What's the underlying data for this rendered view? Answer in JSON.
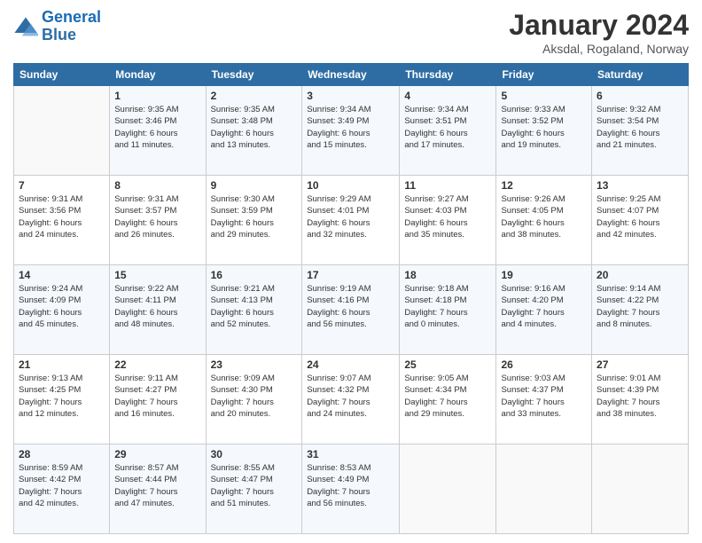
{
  "logo": {
    "line1": "General",
    "line2": "Blue"
  },
  "title": "January 2024",
  "subtitle": "Aksdal, Rogaland, Norway",
  "header_days": [
    "Sunday",
    "Monday",
    "Tuesday",
    "Wednesday",
    "Thursday",
    "Friday",
    "Saturday"
  ],
  "weeks": [
    [
      {
        "day": "",
        "info": ""
      },
      {
        "day": "1",
        "info": "Sunrise: 9:35 AM\nSunset: 3:46 PM\nDaylight: 6 hours\nand 11 minutes."
      },
      {
        "day": "2",
        "info": "Sunrise: 9:35 AM\nSunset: 3:48 PM\nDaylight: 6 hours\nand 13 minutes."
      },
      {
        "day": "3",
        "info": "Sunrise: 9:34 AM\nSunset: 3:49 PM\nDaylight: 6 hours\nand 15 minutes."
      },
      {
        "day": "4",
        "info": "Sunrise: 9:34 AM\nSunset: 3:51 PM\nDaylight: 6 hours\nand 17 minutes."
      },
      {
        "day": "5",
        "info": "Sunrise: 9:33 AM\nSunset: 3:52 PM\nDaylight: 6 hours\nand 19 minutes."
      },
      {
        "day": "6",
        "info": "Sunrise: 9:32 AM\nSunset: 3:54 PM\nDaylight: 6 hours\nand 21 minutes."
      }
    ],
    [
      {
        "day": "7",
        "info": "Sunrise: 9:31 AM\nSunset: 3:56 PM\nDaylight: 6 hours\nand 24 minutes."
      },
      {
        "day": "8",
        "info": "Sunrise: 9:31 AM\nSunset: 3:57 PM\nDaylight: 6 hours\nand 26 minutes."
      },
      {
        "day": "9",
        "info": "Sunrise: 9:30 AM\nSunset: 3:59 PM\nDaylight: 6 hours\nand 29 minutes."
      },
      {
        "day": "10",
        "info": "Sunrise: 9:29 AM\nSunset: 4:01 PM\nDaylight: 6 hours\nand 32 minutes."
      },
      {
        "day": "11",
        "info": "Sunrise: 9:27 AM\nSunset: 4:03 PM\nDaylight: 6 hours\nand 35 minutes."
      },
      {
        "day": "12",
        "info": "Sunrise: 9:26 AM\nSunset: 4:05 PM\nDaylight: 6 hours\nand 38 minutes."
      },
      {
        "day": "13",
        "info": "Sunrise: 9:25 AM\nSunset: 4:07 PM\nDaylight: 6 hours\nand 42 minutes."
      }
    ],
    [
      {
        "day": "14",
        "info": "Sunrise: 9:24 AM\nSunset: 4:09 PM\nDaylight: 6 hours\nand 45 minutes."
      },
      {
        "day": "15",
        "info": "Sunrise: 9:22 AM\nSunset: 4:11 PM\nDaylight: 6 hours\nand 48 minutes."
      },
      {
        "day": "16",
        "info": "Sunrise: 9:21 AM\nSunset: 4:13 PM\nDaylight: 6 hours\nand 52 minutes."
      },
      {
        "day": "17",
        "info": "Sunrise: 9:19 AM\nSunset: 4:16 PM\nDaylight: 6 hours\nand 56 minutes."
      },
      {
        "day": "18",
        "info": "Sunrise: 9:18 AM\nSunset: 4:18 PM\nDaylight: 7 hours\nand 0 minutes."
      },
      {
        "day": "19",
        "info": "Sunrise: 9:16 AM\nSunset: 4:20 PM\nDaylight: 7 hours\nand 4 minutes."
      },
      {
        "day": "20",
        "info": "Sunrise: 9:14 AM\nSunset: 4:22 PM\nDaylight: 7 hours\nand 8 minutes."
      }
    ],
    [
      {
        "day": "21",
        "info": "Sunrise: 9:13 AM\nSunset: 4:25 PM\nDaylight: 7 hours\nand 12 minutes."
      },
      {
        "day": "22",
        "info": "Sunrise: 9:11 AM\nSunset: 4:27 PM\nDaylight: 7 hours\nand 16 minutes."
      },
      {
        "day": "23",
        "info": "Sunrise: 9:09 AM\nSunset: 4:30 PM\nDaylight: 7 hours\nand 20 minutes."
      },
      {
        "day": "24",
        "info": "Sunrise: 9:07 AM\nSunset: 4:32 PM\nDaylight: 7 hours\nand 24 minutes."
      },
      {
        "day": "25",
        "info": "Sunrise: 9:05 AM\nSunset: 4:34 PM\nDaylight: 7 hours\nand 29 minutes."
      },
      {
        "day": "26",
        "info": "Sunrise: 9:03 AM\nSunset: 4:37 PM\nDaylight: 7 hours\nand 33 minutes."
      },
      {
        "day": "27",
        "info": "Sunrise: 9:01 AM\nSunset: 4:39 PM\nDaylight: 7 hours\nand 38 minutes."
      }
    ],
    [
      {
        "day": "28",
        "info": "Sunrise: 8:59 AM\nSunset: 4:42 PM\nDaylight: 7 hours\nand 42 minutes."
      },
      {
        "day": "29",
        "info": "Sunrise: 8:57 AM\nSunset: 4:44 PM\nDaylight: 7 hours\nand 47 minutes."
      },
      {
        "day": "30",
        "info": "Sunrise: 8:55 AM\nSunset: 4:47 PM\nDaylight: 7 hours\nand 51 minutes."
      },
      {
        "day": "31",
        "info": "Sunrise: 8:53 AM\nSunset: 4:49 PM\nDaylight: 7 hours\nand 56 minutes."
      },
      {
        "day": "",
        "info": ""
      },
      {
        "day": "",
        "info": ""
      },
      {
        "day": "",
        "info": ""
      }
    ]
  ]
}
